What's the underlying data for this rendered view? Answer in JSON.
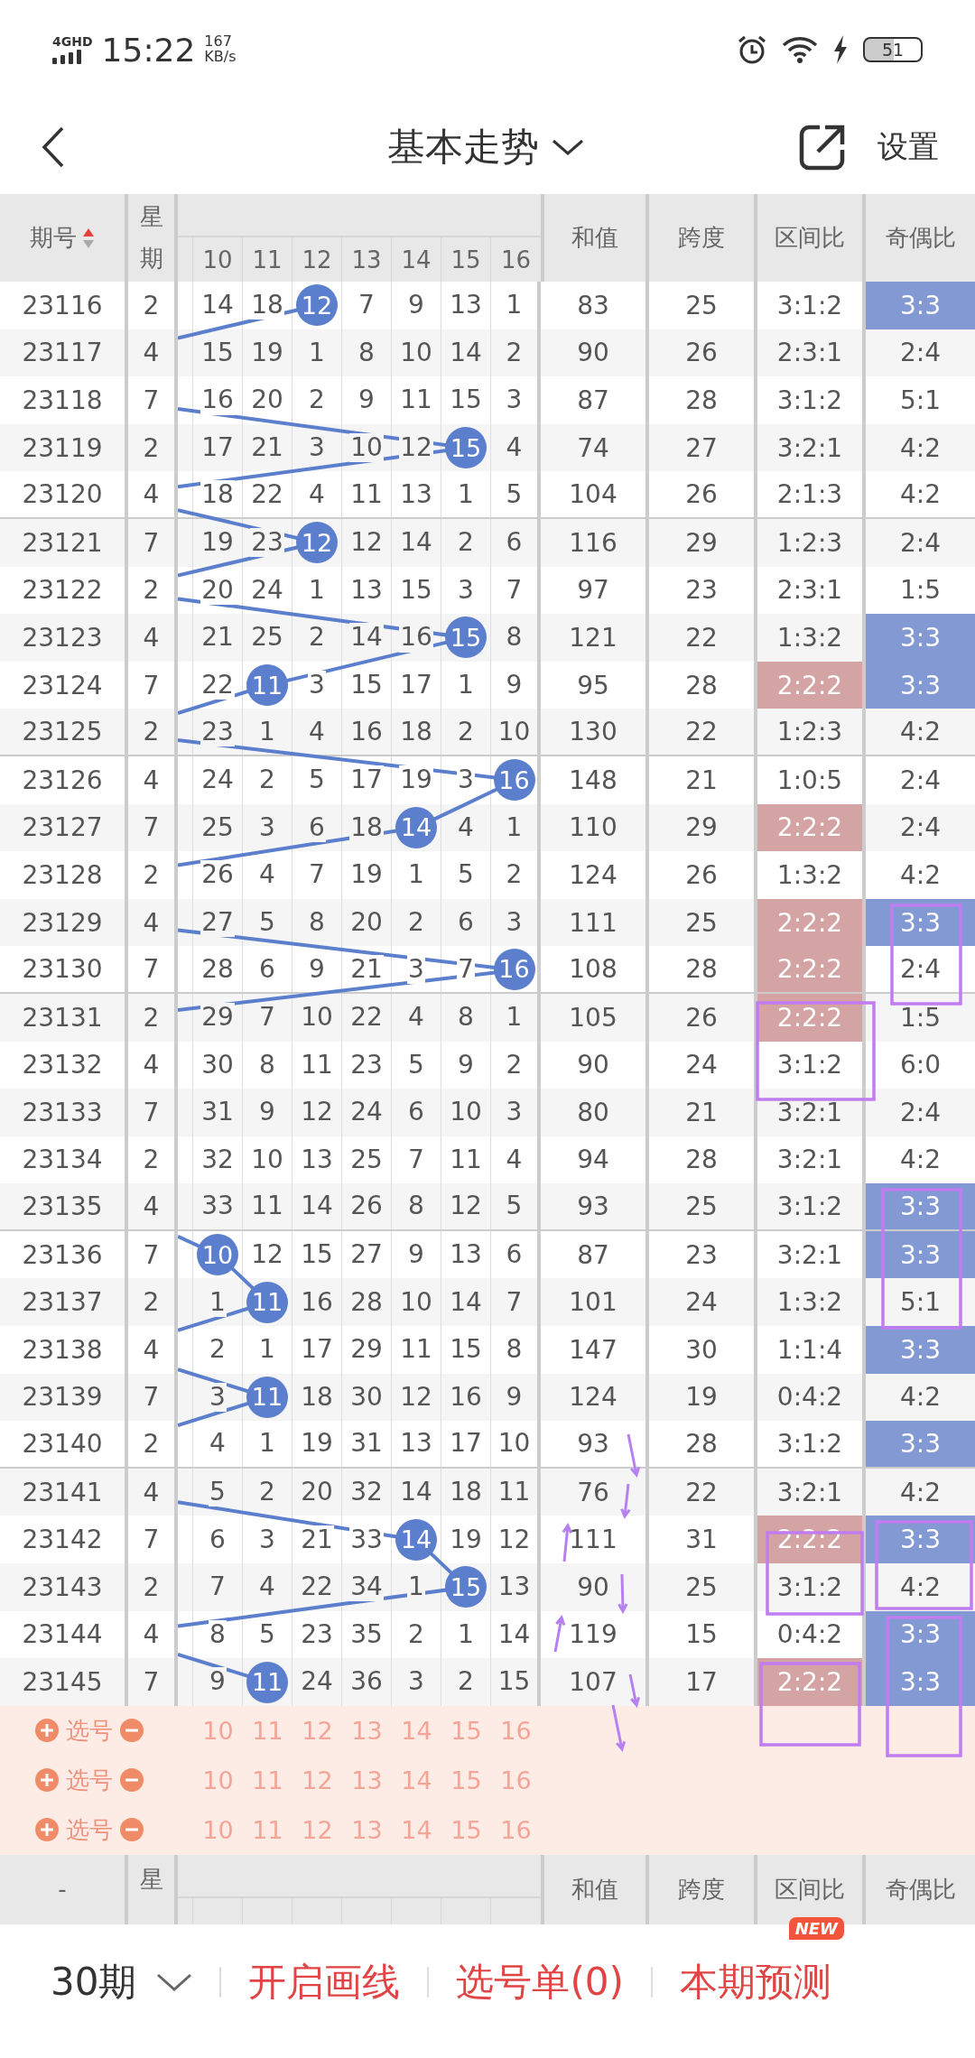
{
  "status_bar": {
    "network": "4GHD",
    "time": "15:22",
    "speed": "167",
    "speed_unit": "KB/s",
    "battery": "51"
  },
  "header": {
    "title": "基本走势",
    "action": "设置"
  },
  "table": {
    "columns": {
      "period": "期号",
      "weekday": "星期",
      "numbers": [
        "10",
        "11",
        "12",
        "13",
        "14",
        "15",
        "16"
      ],
      "sum": "和值",
      "span": "跨度",
      "zone_ratio": "区间比",
      "odd_even": "奇偶比"
    },
    "rows": [
      {
        "period": "23116",
        "weekday": "2",
        "cells": [
          {
            "n": "14",
            "hit": false
          },
          {
            "n": "18",
            "hit": false
          },
          {
            "n": "12",
            "hit": true
          },
          {
            "n": "7",
            "hit": false
          },
          {
            "n": "9",
            "hit": false
          },
          {
            "n": "13",
            "hit": false
          },
          {
            "n": "1",
            "hit": false
          }
        ],
        "sum": "83",
        "span": "25",
        "zone_ratio": {
          "text": "3:1:2",
          "highlighted": false
        },
        "odd_even": {
          "text": "3:3",
          "highlighted": true
        }
      },
      {
        "period": "23117",
        "weekday": "4",
        "cells": [
          {
            "n": "15",
            "hit": false
          },
          {
            "n": "19",
            "hit": false
          },
          {
            "n": "1",
            "hit": false
          },
          {
            "n": "8",
            "hit": false
          },
          {
            "n": "10",
            "hit": false
          },
          {
            "n": "14",
            "hit": false
          },
          {
            "n": "2",
            "hit": false
          }
        ],
        "sum": "90",
        "span": "26",
        "zone_ratio": {
          "text": "2:3:1",
          "highlighted": false
        },
        "odd_even": {
          "text": "2:4",
          "highlighted": false
        }
      },
      {
        "period": "23118",
        "weekday": "7",
        "cells": [
          {
            "n": "16",
            "hit": false
          },
          {
            "n": "20",
            "hit": false
          },
          {
            "n": "2",
            "hit": false
          },
          {
            "n": "9",
            "hit": false
          },
          {
            "n": "11",
            "hit": false
          },
          {
            "n": "15",
            "hit": false
          },
          {
            "n": "3",
            "hit": false
          }
        ],
        "sum": "87",
        "span": "28",
        "zone_ratio": {
          "text": "3:1:2",
          "highlighted": false
        },
        "odd_even": {
          "text": "5:1",
          "highlighted": false
        }
      },
      {
        "period": "23119",
        "weekday": "2",
        "cells": [
          {
            "n": "17",
            "hit": false
          },
          {
            "n": "21",
            "hit": false
          },
          {
            "n": "3",
            "hit": false
          },
          {
            "n": "10",
            "hit": false
          },
          {
            "n": "12",
            "hit": false
          },
          {
            "n": "15",
            "hit": true
          },
          {
            "n": "4",
            "hit": false
          }
        ],
        "sum": "74",
        "span": "27",
        "zone_ratio": {
          "text": "3:2:1",
          "highlighted": false
        },
        "odd_even": {
          "text": "4:2",
          "highlighted": false
        }
      },
      {
        "period": "23120",
        "weekday": "4",
        "cells": [
          {
            "n": "18",
            "hit": false
          },
          {
            "n": "22",
            "hit": false
          },
          {
            "n": "4",
            "hit": false
          },
          {
            "n": "11",
            "hit": false
          },
          {
            "n": "13",
            "hit": false
          },
          {
            "n": "1",
            "hit": false
          },
          {
            "n": "5",
            "hit": false
          }
        ],
        "sum": "104",
        "span": "26",
        "zone_ratio": {
          "text": "2:1:3",
          "highlighted": false
        },
        "odd_even": {
          "text": "4:2",
          "highlighted": false
        }
      },
      {
        "period": "23121",
        "weekday": "7",
        "cells": [
          {
            "n": "19",
            "hit": false
          },
          {
            "n": "23",
            "hit": false
          },
          {
            "n": "12",
            "hit": true
          },
          {
            "n": "12",
            "hit": false
          },
          {
            "n": "14",
            "hit": false
          },
          {
            "n": "2",
            "hit": false
          },
          {
            "n": "6",
            "hit": false
          }
        ],
        "sum": "116",
        "span": "29",
        "zone_ratio": {
          "text": "1:2:3",
          "highlighted": false
        },
        "odd_even": {
          "text": "2:4",
          "highlighted": false
        }
      },
      {
        "period": "23122",
        "weekday": "2",
        "cells": [
          {
            "n": "20",
            "hit": false
          },
          {
            "n": "24",
            "hit": false
          },
          {
            "n": "1",
            "hit": false
          },
          {
            "n": "13",
            "hit": false
          },
          {
            "n": "15",
            "hit": false
          },
          {
            "n": "3",
            "hit": false
          },
          {
            "n": "7",
            "hit": false
          }
        ],
        "sum": "97",
        "span": "23",
        "zone_ratio": {
          "text": "2:3:1",
          "highlighted": false
        },
        "odd_even": {
          "text": "1:5",
          "highlighted": false
        }
      },
      {
        "period": "23123",
        "weekday": "4",
        "cells": [
          {
            "n": "21",
            "hit": false
          },
          {
            "n": "25",
            "hit": false
          },
          {
            "n": "2",
            "hit": false
          },
          {
            "n": "14",
            "hit": false
          },
          {
            "n": "16",
            "hit": false
          },
          {
            "n": "15",
            "hit": true
          },
          {
            "n": "8",
            "hit": false
          }
        ],
        "sum": "121",
        "span": "22",
        "zone_ratio": {
          "text": "1:3:2",
          "highlighted": false
        },
        "odd_even": {
          "text": "3:3",
          "highlighted": true
        }
      },
      {
        "period": "23124",
        "weekday": "7",
        "cells": [
          {
            "n": "22",
            "hit": false
          },
          {
            "n": "11",
            "hit": true
          },
          {
            "n": "3",
            "hit": false
          },
          {
            "n": "15",
            "hit": false
          },
          {
            "n": "17",
            "hit": false
          },
          {
            "n": "1",
            "hit": false
          },
          {
            "n": "9",
            "hit": false
          }
        ],
        "sum": "95",
        "span": "28",
        "zone_ratio": {
          "text": "2:2:2",
          "highlighted": true
        },
        "odd_even": {
          "text": "3:3",
          "highlighted": true
        }
      },
      {
        "period": "23125",
        "weekday": "2",
        "cells": [
          {
            "n": "23",
            "hit": false
          },
          {
            "n": "1",
            "hit": false
          },
          {
            "n": "4",
            "hit": false
          },
          {
            "n": "16",
            "hit": false
          },
          {
            "n": "18",
            "hit": false
          },
          {
            "n": "2",
            "hit": false
          },
          {
            "n": "10",
            "hit": false
          }
        ],
        "sum": "130",
        "span": "22",
        "zone_ratio": {
          "text": "1:2:3",
          "highlighted": false
        },
        "odd_even": {
          "text": "4:2",
          "highlighted": false
        }
      },
      {
        "period": "23126",
        "weekday": "4",
        "cells": [
          {
            "n": "24",
            "hit": false
          },
          {
            "n": "2",
            "hit": false
          },
          {
            "n": "5",
            "hit": false
          },
          {
            "n": "17",
            "hit": false
          },
          {
            "n": "19",
            "hit": false
          },
          {
            "n": "3",
            "hit": false
          },
          {
            "n": "16",
            "hit": true
          }
        ],
        "sum": "148",
        "span": "21",
        "zone_ratio": {
          "text": "1:0:5",
          "highlighted": false
        },
        "odd_even": {
          "text": "2:4",
          "highlighted": false
        }
      },
      {
        "period": "23127",
        "weekday": "7",
        "cells": [
          {
            "n": "25",
            "hit": false
          },
          {
            "n": "3",
            "hit": false
          },
          {
            "n": "6",
            "hit": false
          },
          {
            "n": "18",
            "hit": false
          },
          {
            "n": "14",
            "hit": true
          },
          {
            "n": "4",
            "hit": false
          },
          {
            "n": "1",
            "hit": false
          }
        ],
        "sum": "110",
        "span": "29",
        "zone_ratio": {
          "text": "2:2:2",
          "highlighted": true
        },
        "odd_even": {
          "text": "2:4",
          "highlighted": false
        }
      },
      {
        "period": "23128",
        "weekday": "2",
        "cells": [
          {
            "n": "26",
            "hit": false
          },
          {
            "n": "4",
            "hit": false
          },
          {
            "n": "7",
            "hit": false
          },
          {
            "n": "19",
            "hit": false
          },
          {
            "n": "1",
            "hit": false
          },
          {
            "n": "5",
            "hit": false
          },
          {
            "n": "2",
            "hit": false
          }
        ],
        "sum": "124",
        "span": "26",
        "zone_ratio": {
          "text": "1:3:2",
          "highlighted": false
        },
        "odd_even": {
          "text": "4:2",
          "highlighted": false
        }
      },
      {
        "period": "23129",
        "weekday": "4",
        "cells": [
          {
            "n": "27",
            "hit": false
          },
          {
            "n": "5",
            "hit": false
          },
          {
            "n": "8",
            "hit": false
          },
          {
            "n": "20",
            "hit": false
          },
          {
            "n": "2",
            "hit": false
          },
          {
            "n": "6",
            "hit": false
          },
          {
            "n": "3",
            "hit": false
          }
        ],
        "sum": "111",
        "span": "25",
        "zone_ratio": {
          "text": "2:2:2",
          "highlighted": true
        },
        "odd_even": {
          "text": "3:3",
          "highlighted": true
        }
      },
      {
        "period": "23130",
        "weekday": "7",
        "cells": [
          {
            "n": "28",
            "hit": false
          },
          {
            "n": "6",
            "hit": false
          },
          {
            "n": "9",
            "hit": false
          },
          {
            "n": "21",
            "hit": false
          },
          {
            "n": "3",
            "hit": false
          },
          {
            "n": "7",
            "hit": false
          },
          {
            "n": "16",
            "hit": true
          }
        ],
        "sum": "108",
        "span": "28",
        "zone_ratio": {
          "text": "2:2:2",
          "highlighted": true
        },
        "odd_even": {
          "text": "2:4",
          "highlighted": false
        }
      },
      {
        "period": "23131",
        "weekday": "2",
        "cells": [
          {
            "n": "29",
            "hit": false
          },
          {
            "n": "7",
            "hit": false
          },
          {
            "n": "10",
            "hit": false
          },
          {
            "n": "22",
            "hit": false
          },
          {
            "n": "4",
            "hit": false
          },
          {
            "n": "8",
            "hit": false
          },
          {
            "n": "1",
            "hit": false
          }
        ],
        "sum": "105",
        "span": "26",
        "zone_ratio": {
          "text": "2:2:2",
          "highlighted": true
        },
        "odd_even": {
          "text": "1:5",
          "highlighted": false
        }
      },
      {
        "period": "23132",
        "weekday": "4",
        "cells": [
          {
            "n": "30",
            "hit": false
          },
          {
            "n": "8",
            "hit": false
          },
          {
            "n": "11",
            "hit": false
          },
          {
            "n": "23",
            "hit": false
          },
          {
            "n": "5",
            "hit": false
          },
          {
            "n": "9",
            "hit": false
          },
          {
            "n": "2",
            "hit": false
          }
        ],
        "sum": "90",
        "span": "24",
        "zone_ratio": {
          "text": "3:1:2",
          "highlighted": false
        },
        "odd_even": {
          "text": "6:0",
          "highlighted": false
        }
      },
      {
        "period": "23133",
        "weekday": "7",
        "cells": [
          {
            "n": "31",
            "hit": false
          },
          {
            "n": "9",
            "hit": false
          },
          {
            "n": "12",
            "hit": false
          },
          {
            "n": "24",
            "hit": false
          },
          {
            "n": "6",
            "hit": false
          },
          {
            "n": "10",
            "hit": false
          },
          {
            "n": "3",
            "hit": false
          }
        ],
        "sum": "80",
        "span": "21",
        "zone_ratio": {
          "text": "3:2:1",
          "highlighted": false
        },
        "odd_even": {
          "text": "2:4",
          "highlighted": false
        }
      },
      {
        "period": "23134",
        "weekday": "2",
        "cells": [
          {
            "n": "32",
            "hit": false
          },
          {
            "n": "10",
            "hit": false
          },
          {
            "n": "13",
            "hit": false
          },
          {
            "n": "25",
            "hit": false
          },
          {
            "n": "7",
            "hit": false
          },
          {
            "n": "11",
            "hit": false
          },
          {
            "n": "4",
            "hit": false
          }
        ],
        "sum": "94",
        "span": "28",
        "zone_ratio": {
          "text": "3:2:1",
          "highlighted": false
        },
        "odd_even": {
          "text": "4:2",
          "highlighted": false
        }
      },
      {
        "period": "23135",
        "weekday": "4",
        "cells": [
          {
            "n": "33",
            "hit": false
          },
          {
            "n": "11",
            "hit": false
          },
          {
            "n": "14",
            "hit": false
          },
          {
            "n": "26",
            "hit": false
          },
          {
            "n": "8",
            "hit": false
          },
          {
            "n": "12",
            "hit": false
          },
          {
            "n": "5",
            "hit": false
          }
        ],
        "sum": "93",
        "span": "25",
        "zone_ratio": {
          "text": "3:1:2",
          "highlighted": false
        },
        "odd_even": {
          "text": "3:3",
          "highlighted": true
        }
      },
      {
        "period": "23136",
        "weekday": "7",
        "cells": [
          {
            "n": "10",
            "hit": true
          },
          {
            "n": "12",
            "hit": false
          },
          {
            "n": "15",
            "hit": false
          },
          {
            "n": "27",
            "hit": false
          },
          {
            "n": "9",
            "hit": false
          },
          {
            "n": "13",
            "hit": false
          },
          {
            "n": "6",
            "hit": false
          }
        ],
        "sum": "87",
        "span": "23",
        "zone_ratio": {
          "text": "3:2:1",
          "highlighted": false
        },
        "odd_even": {
          "text": "3:3",
          "highlighted": true
        }
      },
      {
        "period": "23137",
        "weekday": "2",
        "cells": [
          {
            "n": "1",
            "hit": false
          },
          {
            "n": "11",
            "hit": true
          },
          {
            "n": "16",
            "hit": false
          },
          {
            "n": "28",
            "hit": false
          },
          {
            "n": "10",
            "hit": false
          },
          {
            "n": "14",
            "hit": false
          },
          {
            "n": "7",
            "hit": false
          }
        ],
        "sum": "101",
        "span": "24",
        "zone_ratio": {
          "text": "1:3:2",
          "highlighted": false
        },
        "odd_even": {
          "text": "5:1",
          "highlighted": false
        }
      },
      {
        "period": "23138",
        "weekday": "4",
        "cells": [
          {
            "n": "2",
            "hit": false
          },
          {
            "n": "1",
            "hit": false
          },
          {
            "n": "17",
            "hit": false
          },
          {
            "n": "29",
            "hit": false
          },
          {
            "n": "11",
            "hit": false
          },
          {
            "n": "15",
            "hit": false
          },
          {
            "n": "8",
            "hit": false
          }
        ],
        "sum": "147",
        "span": "30",
        "zone_ratio": {
          "text": "1:1:4",
          "highlighted": false
        },
        "odd_even": {
          "text": "3:3",
          "highlighted": true
        }
      },
      {
        "period": "23139",
        "weekday": "7",
        "cells": [
          {
            "n": "3",
            "hit": false
          },
          {
            "n": "11",
            "hit": true
          },
          {
            "n": "18",
            "hit": false
          },
          {
            "n": "30",
            "hit": false
          },
          {
            "n": "12",
            "hit": false
          },
          {
            "n": "16",
            "hit": false
          },
          {
            "n": "9",
            "hit": false
          }
        ],
        "sum": "124",
        "span": "19",
        "zone_ratio": {
          "text": "0:4:2",
          "highlighted": false
        },
        "odd_even": {
          "text": "4:2",
          "highlighted": false
        }
      },
      {
        "period": "23140",
        "weekday": "2",
        "cells": [
          {
            "n": "4",
            "hit": false
          },
          {
            "n": "1",
            "hit": false
          },
          {
            "n": "19",
            "hit": false
          },
          {
            "n": "31",
            "hit": false
          },
          {
            "n": "13",
            "hit": false
          },
          {
            "n": "17",
            "hit": false
          },
          {
            "n": "10",
            "hit": false
          }
        ],
        "sum": "93",
        "span": "28",
        "zone_ratio": {
          "text": "3:1:2",
          "highlighted": false
        },
        "odd_even": {
          "text": "3:3",
          "highlighted": true
        }
      },
      {
        "period": "23141",
        "weekday": "4",
        "cells": [
          {
            "n": "5",
            "hit": false
          },
          {
            "n": "2",
            "hit": false
          },
          {
            "n": "20",
            "hit": false
          },
          {
            "n": "32",
            "hit": false
          },
          {
            "n": "14",
            "hit": false
          },
          {
            "n": "18",
            "hit": false
          },
          {
            "n": "11",
            "hit": false
          }
        ],
        "sum": "76",
        "span": "22",
        "zone_ratio": {
          "text": "3:2:1",
          "highlighted": false
        },
        "odd_even": {
          "text": "4:2",
          "highlighted": false
        }
      },
      {
        "period": "23142",
        "weekday": "7",
        "cells": [
          {
            "n": "6",
            "hit": false
          },
          {
            "n": "3",
            "hit": false
          },
          {
            "n": "21",
            "hit": false
          },
          {
            "n": "33",
            "hit": false
          },
          {
            "n": "14",
            "hit": true
          },
          {
            "n": "19",
            "hit": false
          },
          {
            "n": "12",
            "hit": false
          }
        ],
        "sum": "111",
        "span": "31",
        "zone_ratio": {
          "text": "2:2:2",
          "highlighted": true
        },
        "odd_even": {
          "text": "3:3",
          "highlighted": true
        }
      },
      {
        "period": "23143",
        "weekday": "2",
        "cells": [
          {
            "n": "7",
            "hit": false
          },
          {
            "n": "4",
            "hit": false
          },
          {
            "n": "22",
            "hit": false
          },
          {
            "n": "34",
            "hit": false
          },
          {
            "n": "1",
            "hit": false
          },
          {
            "n": "15",
            "hit": true
          },
          {
            "n": "13",
            "hit": false
          }
        ],
        "sum": "90",
        "span": "25",
        "zone_ratio": {
          "text": "3:1:2",
          "highlighted": false
        },
        "odd_even": {
          "text": "4:2",
          "highlighted": false
        }
      },
      {
        "period": "23144",
        "weekday": "4",
        "cells": [
          {
            "n": "8",
            "hit": false
          },
          {
            "n": "5",
            "hit": false
          },
          {
            "n": "23",
            "hit": false
          },
          {
            "n": "35",
            "hit": false
          },
          {
            "n": "2",
            "hit": false
          },
          {
            "n": "1",
            "hit": false
          },
          {
            "n": "14",
            "hit": false
          }
        ],
        "sum": "119",
        "span": "15",
        "zone_ratio": {
          "text": "0:4:2",
          "highlighted": false
        },
        "odd_even": {
          "text": "3:3",
          "highlighted": true
        }
      },
      {
        "period": "23145",
        "weekday": "7",
        "cells": [
          {
            "n": "9",
            "hit": false
          },
          {
            "n": "11",
            "hit": true
          },
          {
            "n": "24",
            "hit": false
          },
          {
            "n": "36",
            "hit": false
          },
          {
            "n": "3",
            "hit": false
          },
          {
            "n": "2",
            "hit": false
          },
          {
            "n": "15",
            "hit": false
          }
        ],
        "sum": "107",
        "span": "17",
        "zone_ratio": {
          "text": "2:2:2",
          "highlighted": true
        },
        "odd_even": {
          "text": "3:3",
          "highlighted": true
        }
      }
    ],
    "pick_rows": [
      {
        "label": "选号",
        "numbers": [
          "10",
          "11",
          "12",
          "13",
          "14",
          "15",
          "16"
        ]
      },
      {
        "label": "选号",
        "numbers": [
          "10",
          "11",
          "12",
          "13",
          "14",
          "15",
          "16"
        ]
      },
      {
        "label": "选号",
        "numbers": [
          "10",
          "11",
          "12",
          "13",
          "14",
          "15",
          "16"
        ]
      }
    ],
    "footer_header": {
      "period": "-",
      "weekday": "星",
      "sum": "和值",
      "span": "跨度",
      "zone_ratio": "区间比",
      "odd_even": "奇偶比"
    }
  },
  "bottom_bar": {
    "period_select": "30期",
    "items": [
      {
        "label": "开启画线"
      },
      {
        "label": "选号单(0)"
      },
      {
        "label": "本期预测",
        "badge": "NEW"
      }
    ]
  }
}
